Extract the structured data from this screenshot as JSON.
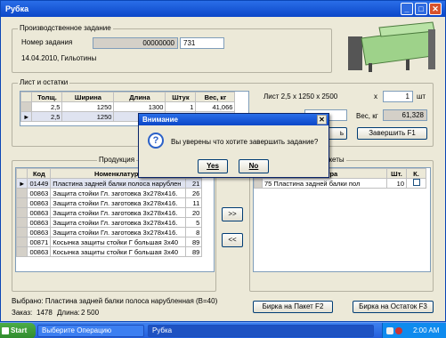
{
  "window": {
    "title": "Рубка",
    "min": "_",
    "max": "□",
    "close": "✕"
  },
  "prod_task": {
    "group": "Производственное задание",
    "number_label": "Номер задания",
    "number_value": "00000000",
    "number_value2": "731",
    "date_line": "14.04.2010, Гильотины"
  },
  "sheet_group": "Лист и остатки",
  "sheet_table": {
    "columns": [
      "Толщ.",
      "Ширина",
      "Длина",
      "Штук",
      "Вес, кг"
    ],
    "rows": [
      [
        "2,5",
        "1250",
        "1300",
        "1",
        "41,066"
      ],
      [
        "2,5",
        "1250",
        "",
        "",
        ""
      ]
    ]
  },
  "sheet_info": {
    "desc": "Лист 2,5 х 1250 х 2500",
    "x_label": "х",
    "qty": "1",
    "qty_unit": "шт",
    "weight_label": "Вес, кг",
    "weight_value": "61,328",
    "btn_partial": "ь",
    "finish_button": "Завершить    F1"
  },
  "products": {
    "group": "Продукция",
    "columns": [
      "Код",
      "Номенклатура",
      ""
    ],
    "rows": [
      [
        "01449",
        "Пластина задней балки полоса нарублен",
        "21"
      ],
      [
        "00863",
        "Защита стойки Гл. заготовка 3х278х416.",
        "26"
      ],
      [
        "00863",
        "Защита стойки Гл. заготовка 3х278х416.",
        "11"
      ],
      [
        "00863",
        "Защита стойки Гл. заготовка 3х278х416.",
        "20"
      ],
      [
        "00863",
        "Защита стойки Гл. заготовка 3х278х416.",
        "5"
      ],
      [
        "00863",
        "Защита стойки Гл. заготовка 3х278х416.",
        "8"
      ],
      [
        "00871",
        "Косынка защиты стойки Г большая 3х40",
        "89"
      ],
      [
        "00863",
        "Косынка защиты стойки Г большая 3х40",
        "89"
      ]
    ]
  },
  "transfer": {
    "right": ">>",
    "left": "<<"
  },
  "packets": {
    "group": "акеты",
    "columns": [
      "клатура",
      "Шт.",
      "К."
    ],
    "rows": [
      [
        "75 Пластина задней балки пол",
        "10",
        ""
      ]
    ]
  },
  "selected": {
    "line1": "Выбрано: Пластина задней балки полоса нарубленная (В=40)",
    "order_label": "Заказ:",
    "order_value": "1478",
    "length_label": "Длина:",
    "length_value": "2 500"
  },
  "tag_packet_button": "Бирка на Пакет    F2",
  "tag_remainder_button": "Бирка на Остаток   F3",
  "dialog": {
    "title": "Внимание",
    "close": "✕",
    "icon": "?",
    "message": "Вы уверены что хотите завершить задание?",
    "yes": "Yes",
    "no": "No"
  },
  "taskbar": {
    "start": "Start",
    "tasks": [
      "Выберите Операцию",
      "Рубка"
    ],
    "clock": "2:00 AM"
  },
  "colors": {
    "title_blue": "#0b46c8",
    "window_bg": "#ece9d8",
    "machine_green": "#9ed28a"
  }
}
